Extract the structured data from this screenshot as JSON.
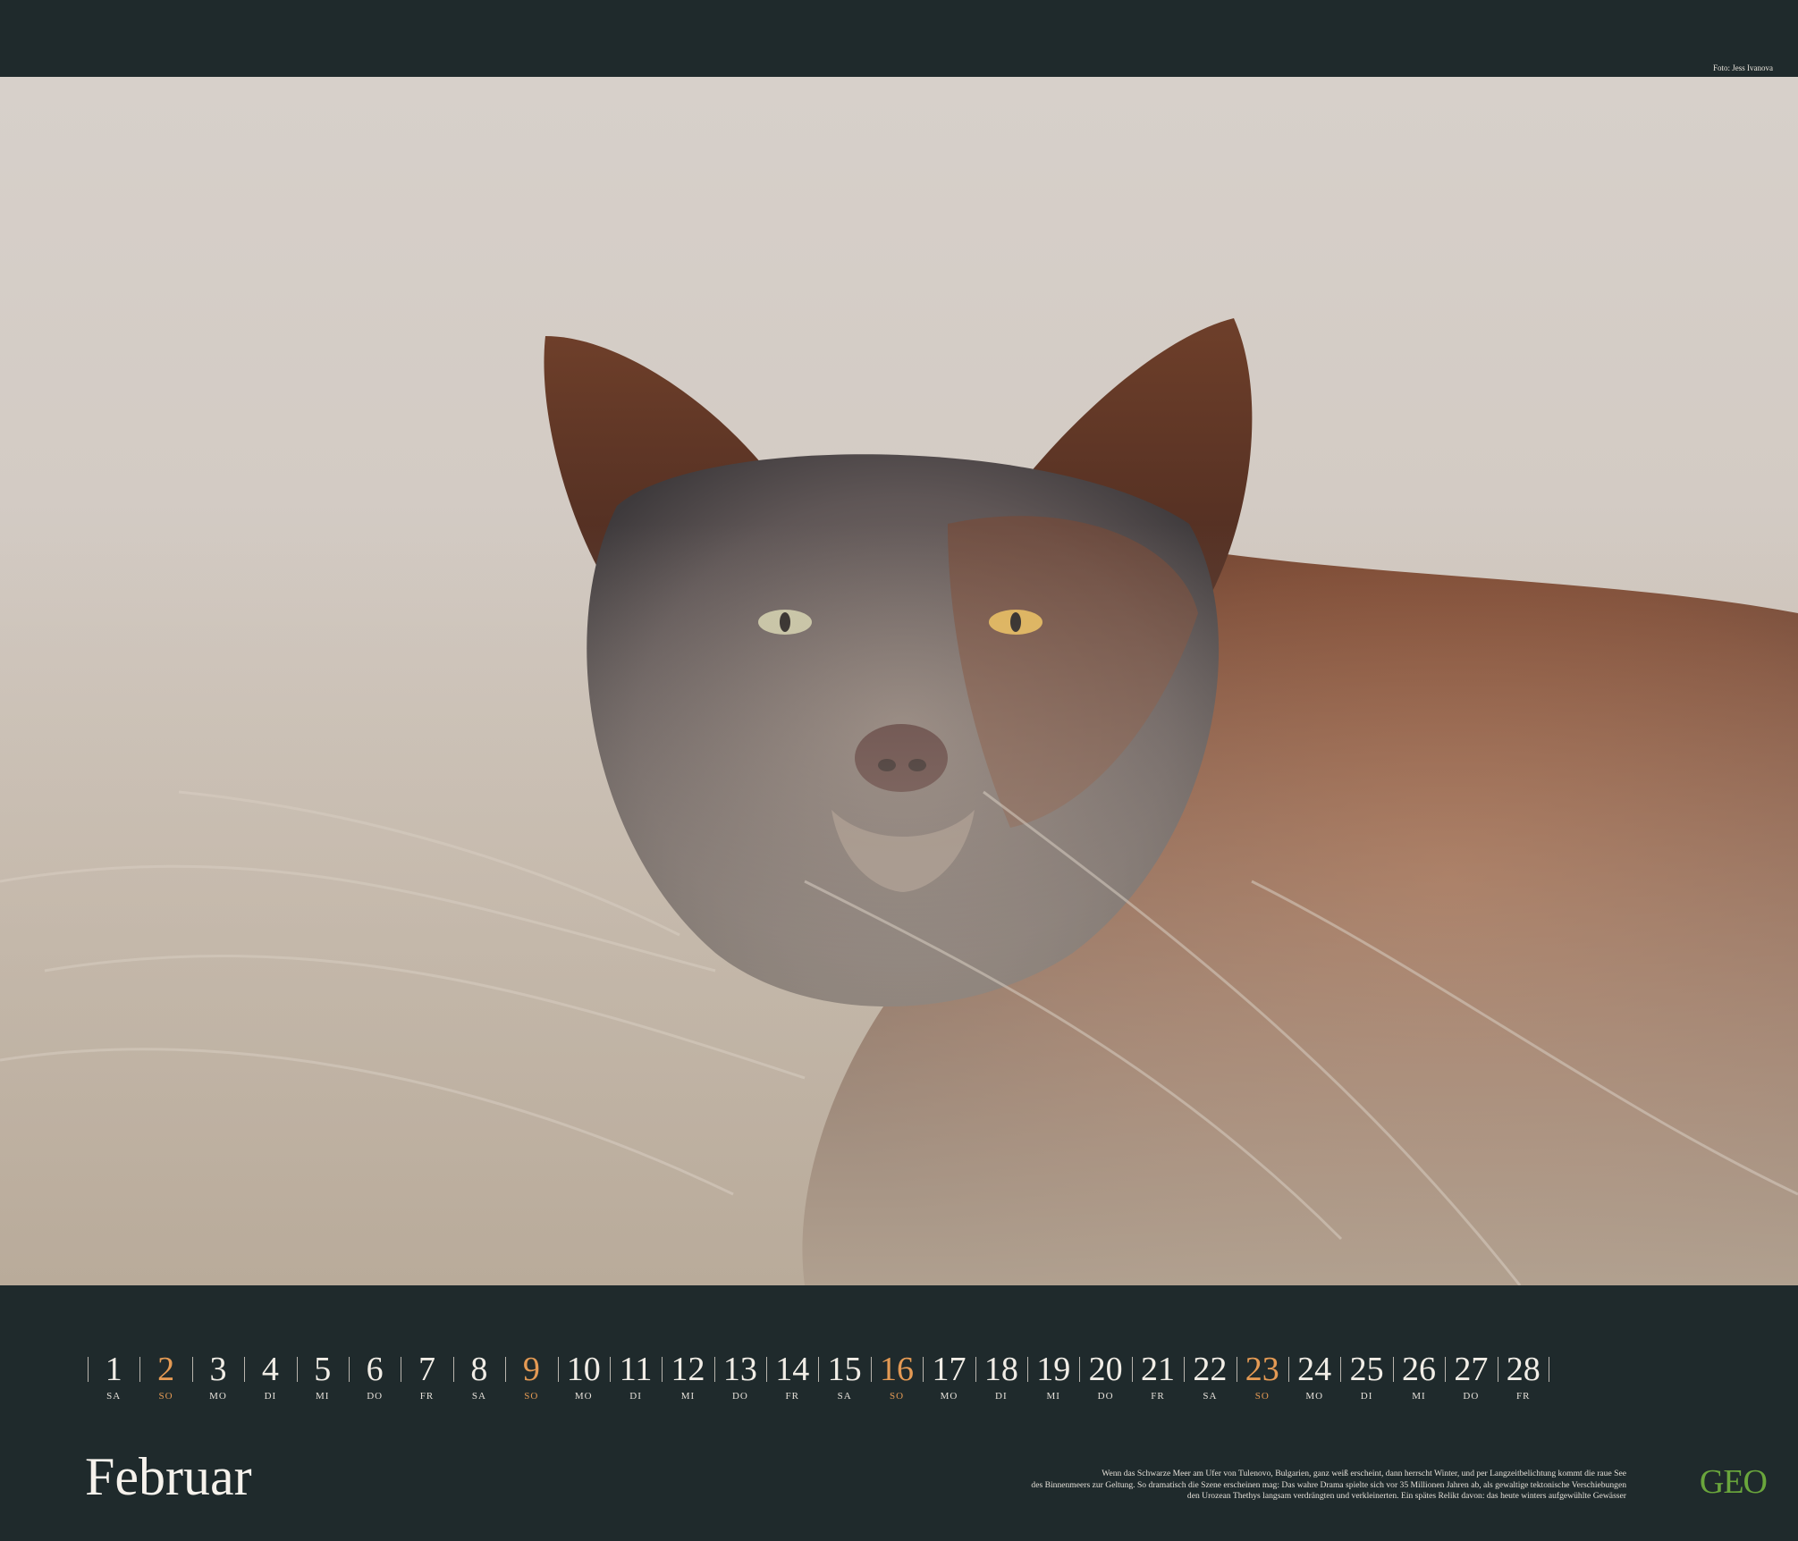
{
  "photo_credit": "Foto: Jess Ivanova",
  "month": "Februar",
  "days": [
    {
      "num": "1",
      "wd": "SA",
      "sunday": false
    },
    {
      "num": "2",
      "wd": "SO",
      "sunday": true
    },
    {
      "num": "3",
      "wd": "MO",
      "sunday": false
    },
    {
      "num": "4",
      "wd": "DI",
      "sunday": false
    },
    {
      "num": "5",
      "wd": "MI",
      "sunday": false
    },
    {
      "num": "6",
      "wd": "DO",
      "sunday": false
    },
    {
      "num": "7",
      "wd": "FR",
      "sunday": false
    },
    {
      "num": "8",
      "wd": "SA",
      "sunday": false
    },
    {
      "num": "9",
      "wd": "SO",
      "sunday": true
    },
    {
      "num": "10",
      "wd": "MO",
      "sunday": false
    },
    {
      "num": "11",
      "wd": "DI",
      "sunday": false
    },
    {
      "num": "12",
      "wd": "MI",
      "sunday": false
    },
    {
      "num": "13",
      "wd": "DO",
      "sunday": false
    },
    {
      "num": "14",
      "wd": "FR",
      "sunday": false
    },
    {
      "num": "15",
      "wd": "SA",
      "sunday": false
    },
    {
      "num": "16",
      "wd": "SO",
      "sunday": true
    },
    {
      "num": "17",
      "wd": "MO",
      "sunday": false
    },
    {
      "num": "18",
      "wd": "DI",
      "sunday": false
    },
    {
      "num": "19",
      "wd": "MI",
      "sunday": false
    },
    {
      "num": "20",
      "wd": "DO",
      "sunday": false
    },
    {
      "num": "21",
      "wd": "FR",
      "sunday": false
    },
    {
      "num": "22",
      "wd": "SA",
      "sunday": false
    },
    {
      "num": "23",
      "wd": "SO",
      "sunday": true
    },
    {
      "num": "24",
      "wd": "MO",
      "sunday": false
    },
    {
      "num": "25",
      "wd": "DI",
      "sunday": false
    },
    {
      "num": "26",
      "wd": "MI",
      "sunday": false
    },
    {
      "num": "27",
      "wd": "DO",
      "sunday": false
    },
    {
      "num": "28",
      "wd": "FR",
      "sunday": false
    }
  ],
  "caption": {
    "lines": [
      "Wenn das Schwarze Meer am Ufer von Tulenovo, Bulgarien, ganz weiß erscheint, dann herrscht Winter, und per Langzeitbelichtung kommt die raue See",
      "des Binnenmeers zur Geltung. So dramatisch die Szene erscheinen mag: Das wahre Drama spielte sich vor 35 Millionen Jahren ab, als gewaltige tektonische Verschiebungen",
      "den Urozean Thethys langsam verdrängten und verkleinerten. Ein spätes Relikt davon: das heute winters aufgewühlte Gewässer"
    ]
  },
  "logo": "GEO",
  "colors": {
    "band": "#1f2a2c",
    "sunday_accent": "#e49a54",
    "logo_green": "#6aa63c"
  }
}
